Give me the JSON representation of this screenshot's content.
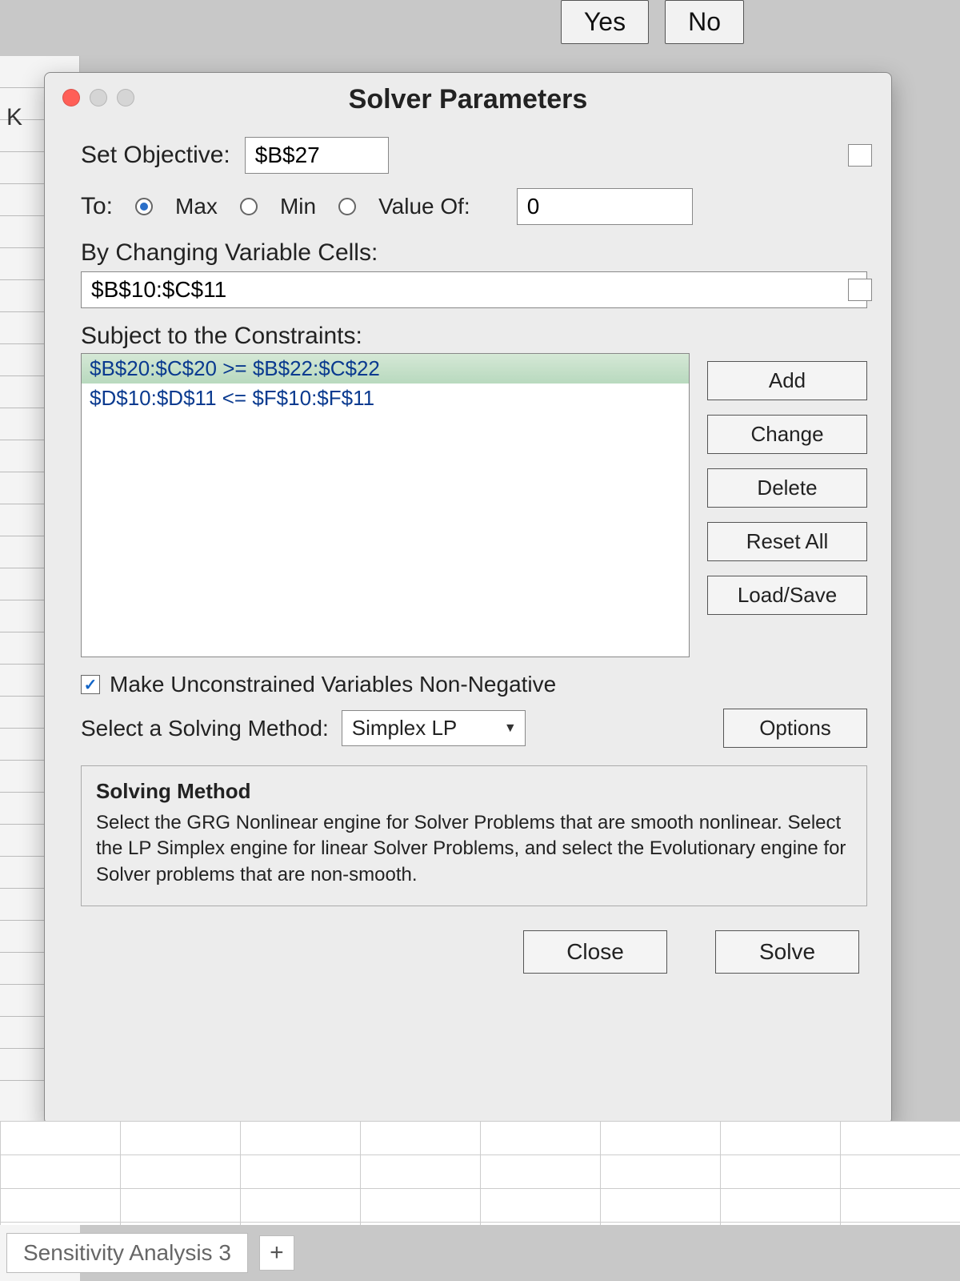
{
  "background": {
    "yes": "Yes",
    "no": "No",
    "column": "K",
    "sheet_tab": "Sensitivity Analysis 3",
    "plus": "+"
  },
  "dialog": {
    "title": "Solver Parameters",
    "set_objective_label": "Set Objective:",
    "set_objective_value": "$B$27",
    "to_label": "To:",
    "radio_max": "Max",
    "radio_min": "Min",
    "radio_valueof": "Value Of:",
    "valueof_value": "0",
    "changing_label": "By Changing Variable Cells:",
    "changing_value": "$B$10:$C$11",
    "constraints_label": "Subject to the Constraints:",
    "constraints": {
      "item0": "$B$20:$C$20 >= $B$22:$C$22",
      "item1": "$D$10:$D$11 <= $F$10:$F$11"
    },
    "buttons": {
      "add": "Add",
      "change": "Change",
      "delete": "Delete",
      "reset": "Reset All",
      "loadsave": "Load/Save",
      "options": "Options",
      "close": "Close",
      "solve": "Solve"
    },
    "nonneg_label": "Make Unconstrained Variables Non-Negative",
    "method_label": "Select a Solving Method:",
    "method_value": "Simplex LP",
    "info_title": "Solving Method",
    "info_text": "Select the GRG Nonlinear engine for Solver Problems that are smooth nonlinear. Select the LP Simplex engine for linear Solver Problems, and select the Evolutionary engine for Solver problems that are non-smooth."
  }
}
